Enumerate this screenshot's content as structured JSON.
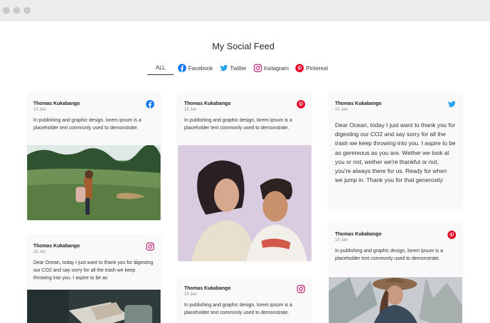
{
  "window": {
    "title": ""
  },
  "feed": {
    "title": "My Social Feed"
  },
  "tabs": [
    {
      "label": "ALL",
      "active": true,
      "icon": ""
    },
    {
      "label": "Facebook",
      "icon": "facebook-icon",
      "color": "#1877f2"
    },
    {
      "label": "Twitter",
      "icon": "twitter-icon",
      "color": "#1da1f2"
    },
    {
      "label": "Instagram",
      "icon": "instagram-icon",
      "color": "#c13584"
    },
    {
      "label": "Pinterest",
      "icon": "pinterest-icon",
      "color": "#e60023"
    }
  ],
  "cards": [
    {
      "author": "Thomas Kukabango",
      "date": "15 Jan",
      "network": "facebook-icon",
      "text": "In publishing and graphic design, lorem ipsum is a placeholder text commonly used to demonstrate.",
      "photo": "woman-in-green-meadow"
    },
    {
      "author": "Thomas Kukabango",
      "date": "15 Jan",
      "network": "instagram-icon",
      "text": "Dear Ocean, today I just want to thank you for digesting our CO2 and say sorry for all the trash we keep throwing into you. I aspire to be as",
      "photo": "hands-holding-book"
    },
    {
      "author": "Thomas Kukabango",
      "date": "15 Jan",
      "network": "pinterest-icon",
      "text": "In publishing and graphic design, lorem ipsum is a placeholder text commonly used to demonstrate.",
      "photo": "young-couple-portrait"
    },
    {
      "author": "Thomas Kukabango",
      "date": "15 Jan",
      "network": "instagram-icon",
      "text": "In publishing and graphic design, lorem ipsum is a placeholder text commonly used to demonstrate."
    },
    {
      "author": "Thomas Kukabango",
      "date": "15 Jan",
      "network": "twitter-icon",
      "text": "Dear Ocean, today I just want to thank you for digesting our CO2 and say sorry for all the trash we keep throwing into you. I aspire to be as gerereous as you are. Wether we look at you or not, wether we're thankful or not, you're always there for us. Ready for when we jump in. Thank you for that generosity"
    },
    {
      "author": "Thomas Kukabango",
      "date": "15 Jan",
      "network": "pinterest-icon",
      "text": "In publishing and graphic design, lorem ipsum is a placeholder text commonly used to demonstrate.",
      "photo": "woman-in-hat-outdoors"
    }
  ]
}
